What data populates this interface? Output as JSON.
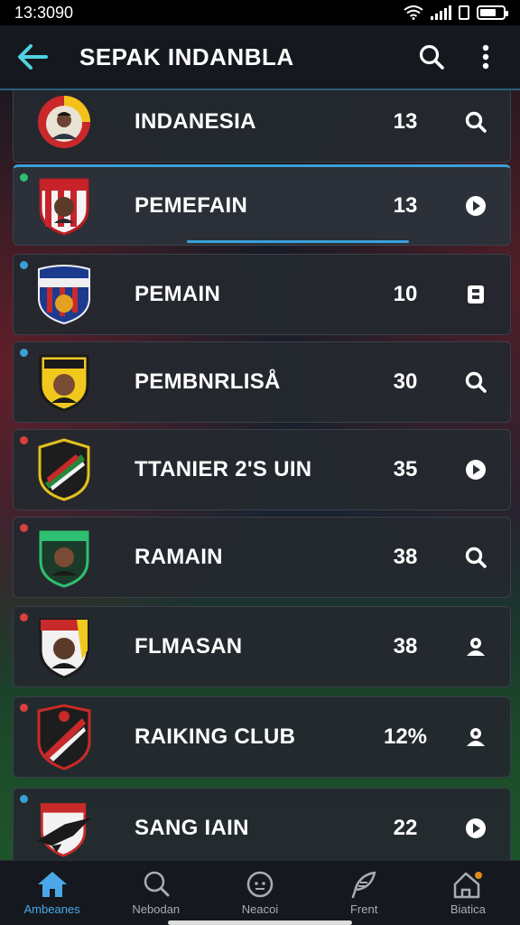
{
  "status": {
    "time": "13:3090"
  },
  "app_bar": {
    "title": "SEPAK INDANBLA"
  },
  "colors": {
    "accent": "#3aa0d8",
    "nav_active": "#4aa8e8"
  },
  "rows": [
    {
      "name": "INDANESIA",
      "value": "13",
      "action_icon": "search-icon",
      "dot": ""
    },
    {
      "name": "PEMEFAIN",
      "value": "13",
      "action_icon": "play-icon",
      "dot": "#2fbf71",
      "selected": true
    },
    {
      "name": "PEMAIN",
      "value": "10",
      "action_icon": "bookmark-icon",
      "dot": "#3aa0d8"
    },
    {
      "name": "PEMBNRLISÅ",
      "value": "30",
      "action_icon": "search-icon",
      "dot": "#3aa0d8"
    },
    {
      "name": "TTANIER 2'S UIN",
      "value": "35",
      "action_icon": "play-icon",
      "dot": "#d94040"
    },
    {
      "name": "RAMAIN",
      "value": "38",
      "action_icon": "search-icon",
      "dot": "#d94040"
    },
    {
      "name": "FLMASAN",
      "value": "38",
      "action_icon": "profile-icon",
      "dot": "#d94040"
    },
    {
      "name": "RAIKING CLUB",
      "value": "12%",
      "action_icon": "profile-icon",
      "dot": "#d94040"
    },
    {
      "name": "SANG IAIN",
      "value": "22",
      "action_icon": "play-icon",
      "dot": "#3aa0d8"
    }
  ],
  "nav": [
    {
      "label": "Ambeanes",
      "icon": "home-icon",
      "active": true
    },
    {
      "label": "Nebodan",
      "icon": "search-icon"
    },
    {
      "label": "Neacoi",
      "icon": "ball-icon"
    },
    {
      "label": "Frent",
      "icon": "feather-icon"
    },
    {
      "label": "Biatica",
      "icon": "house-badge-icon"
    }
  ]
}
